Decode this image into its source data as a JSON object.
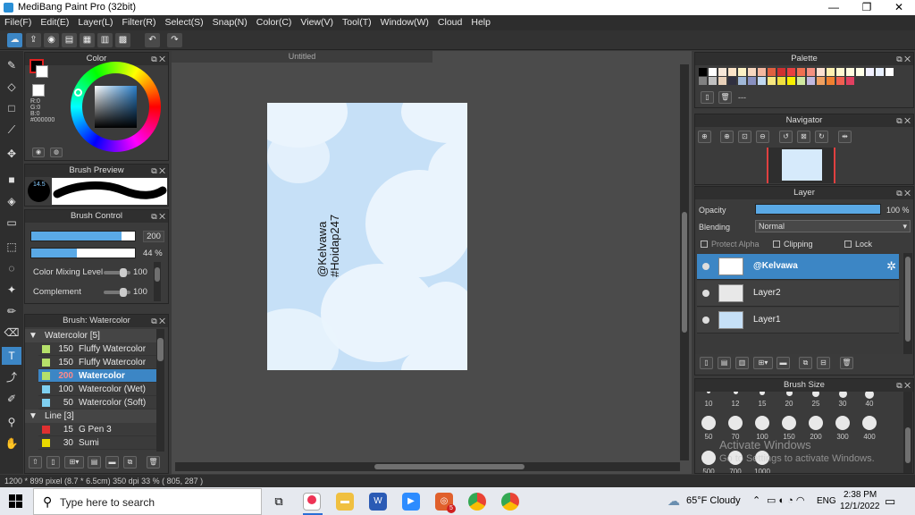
{
  "window": {
    "title": "MediBang Paint Pro (32bit)",
    "minimize": "—",
    "maximize": "❐",
    "close": "✕"
  },
  "menu": [
    "File(F)",
    "Edit(E)",
    "Layer(L)",
    "Filter(R)",
    "Select(S)",
    "Snap(N)",
    "Color(C)",
    "View(V)",
    "Tool(T)",
    "Window(W)",
    "Cloud",
    "Help"
  ],
  "color_panel": {
    "title": "Color",
    "r": "R:0",
    "g": "G:0",
    "b": "B:0",
    "hex": "#000000",
    "fg_color": "#000000",
    "bg_color": "#ffffff"
  },
  "brush_preview": {
    "title": "Brush Preview",
    "size_label": "14.5"
  },
  "brush_control": {
    "title": "Brush Control",
    "size_value": "200",
    "size_fraction": 0.87,
    "opacity_value": "44 %",
    "opacity_fraction": 0.44,
    "color_mixing_label": "Color Mixing Level",
    "color_mixing_value": "100",
    "complement_label": "Complement",
    "complement_value": "100"
  },
  "brush_list": {
    "title": "Brush: Watercolor",
    "groups": [
      {
        "name": "Watercolor [5]",
        "items": [
          {
            "size": "150",
            "name": "Fluffy Watercolor",
            "color": "#b5e06a"
          },
          {
            "size": "150",
            "name": "Fluffy Watercolor",
            "color": "#b5e06a"
          },
          {
            "size": "200",
            "name": "Watercolor",
            "color": "#b5e06a",
            "selected": true
          },
          {
            "size": "100",
            "name": "Watercolor (Wet)",
            "color": "#7fd0f0"
          },
          {
            "size": "50",
            "name": "Watercolor (Soft)",
            "color": "#7fd0f0"
          }
        ]
      },
      {
        "name": "Line [3]",
        "items": [
          {
            "size": "15",
            "name": "G Pen 3",
            "color": "#e03030"
          },
          {
            "size": "30",
            "name": "Sumi",
            "color": "#e8d800"
          }
        ]
      }
    ]
  },
  "document": {
    "tab": "Untitled",
    "text_line1": "@Kelvawa",
    "text_line2": "#Hoidap247"
  },
  "palette": {
    "title": "Palette",
    "swatches_row1": [
      "#000000",
      "#ffffff",
      "#f6e7d8",
      "#fce4c8",
      "#fdf2c4",
      "#f7d8c0",
      "#f4b8a0",
      "#e06040",
      "#d03030",
      "#e84040",
      "#f07050",
      "#f49080",
      "#fce0d0",
      "#fff0b0",
      "#fff8d0",
      "#fffce0",
      "#ffffe8",
      "#f0f0ff",
      "#e8f0ff",
      "#ffffff"
    ],
    "swatches_row2": [
      "#808080",
      "#c0c0c0",
      "#e8d0b8",
      "#303040",
      "#a0b8d8",
      "#8890c0",
      "#c0d8f0",
      "#f8e880",
      "#f0e040",
      "#f8f000",
      "#d0e8a0",
      "#c0b8e0",
      "#f0a060",
      "#f08030",
      "#f06050",
      "#e04060"
    ],
    "dash": "---"
  },
  "navigator": {
    "title": "Navigator"
  },
  "layer_panel": {
    "title": "Layer",
    "opacity_label": "Opacity",
    "opacity_value": "100 %",
    "blending_label": "Blending",
    "blending_value": "Normal",
    "protect_alpha": "Protect Alpha",
    "clipping": "Clipping",
    "lock": "Lock",
    "layers": [
      {
        "name": "@Kelvawa",
        "selected": true
      },
      {
        "name": "Layer2",
        "selected": false
      },
      {
        "name": "Layer1",
        "selected": false
      }
    ]
  },
  "brush_size": {
    "title": "Brush Size",
    "row1": [
      "10",
      "12",
      "15",
      "20",
      "25",
      "30",
      "40"
    ],
    "row2": [
      "50",
      "70",
      "100",
      "150",
      "200",
      "300",
      "400"
    ],
    "row3": [
      "500",
      "700",
      "1000"
    ]
  },
  "watermark": {
    "line1": "Activate Windows",
    "line2": "Go to Settings to activate Windows."
  },
  "status": {
    "text": "1200 * 899 pixel  (8.7 * 6.5cm)  350 dpi  33 %  ( 805, 287 )"
  },
  "taskbar": {
    "search_placeholder": "Type here to search",
    "weather": "65°F  Cloudy",
    "lang": "ENG",
    "time": "2:38 PM",
    "date": "12/1/2022",
    "badge": "5"
  }
}
